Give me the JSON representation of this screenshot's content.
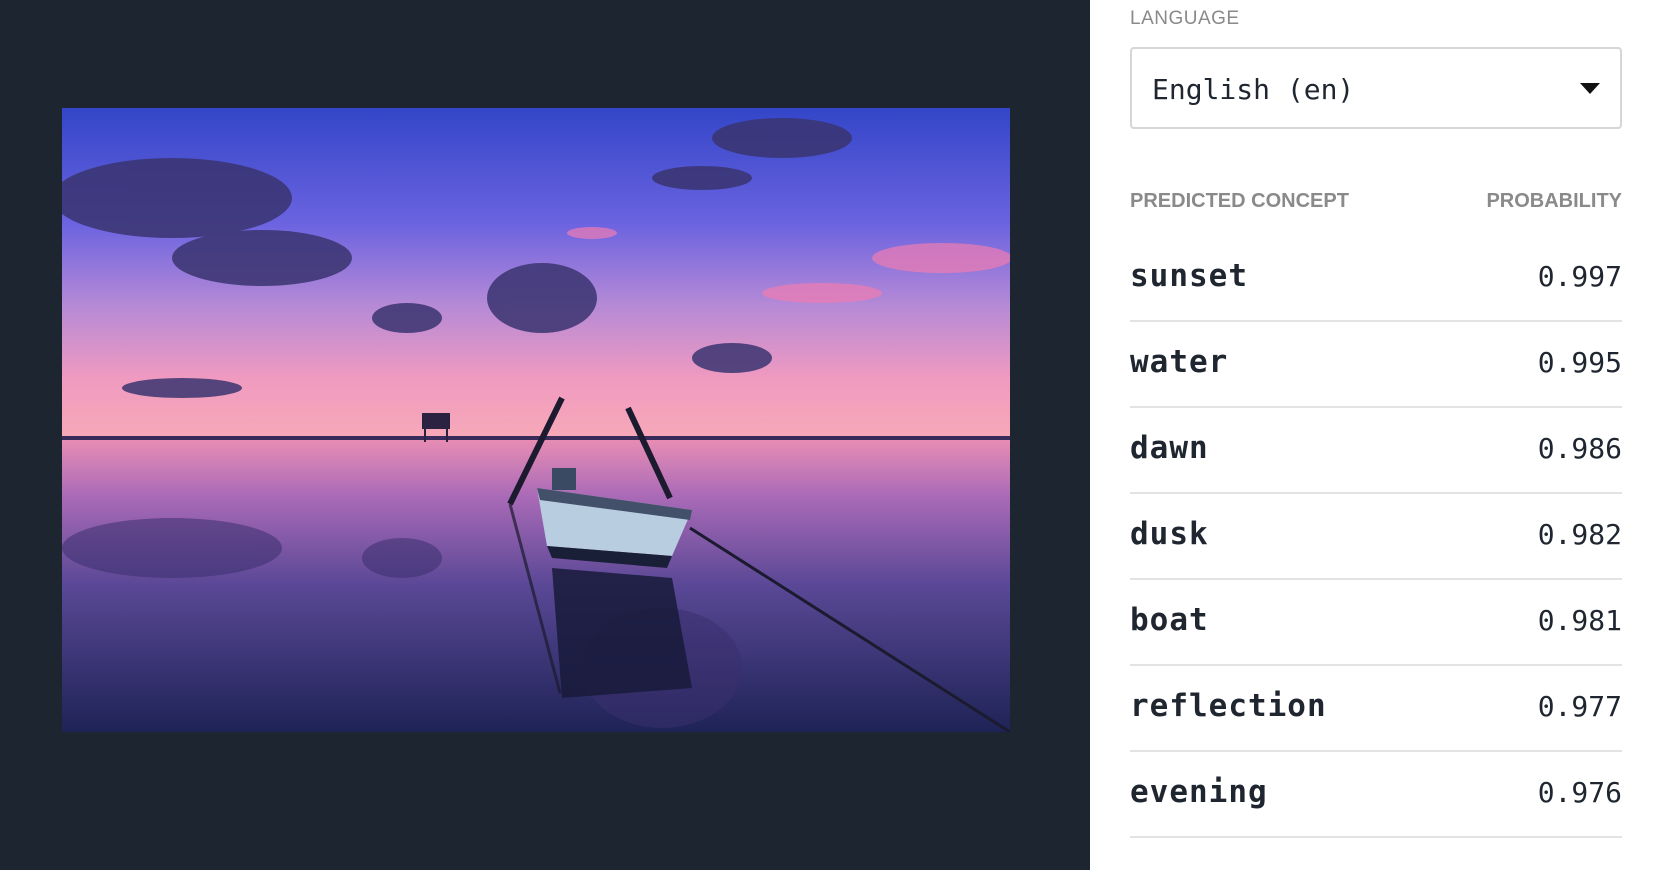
{
  "language": {
    "label": "LANGUAGE",
    "selected": "English (en)"
  },
  "table": {
    "header_concept": "PREDICTED CONCEPT",
    "header_probability": "PROBABILITY",
    "rows": [
      {
        "concept": "sunset",
        "probability": "0.997"
      },
      {
        "concept": "water",
        "probability": "0.995"
      },
      {
        "concept": "dawn",
        "probability": "0.986"
      },
      {
        "concept": "dusk",
        "probability": "0.982"
      },
      {
        "concept": "boat",
        "probability": "0.981"
      },
      {
        "concept": "reflection",
        "probability": "0.977"
      },
      {
        "concept": "evening",
        "probability": "0.976"
      }
    ]
  },
  "colors": {
    "left_panel_bg": "#1c2530",
    "text_dark": "#1f2630",
    "text_muted": "#8a8a8a",
    "divider": "#e3e3e3"
  },
  "image": {
    "subject": "sunset-lake-boat-photo"
  }
}
